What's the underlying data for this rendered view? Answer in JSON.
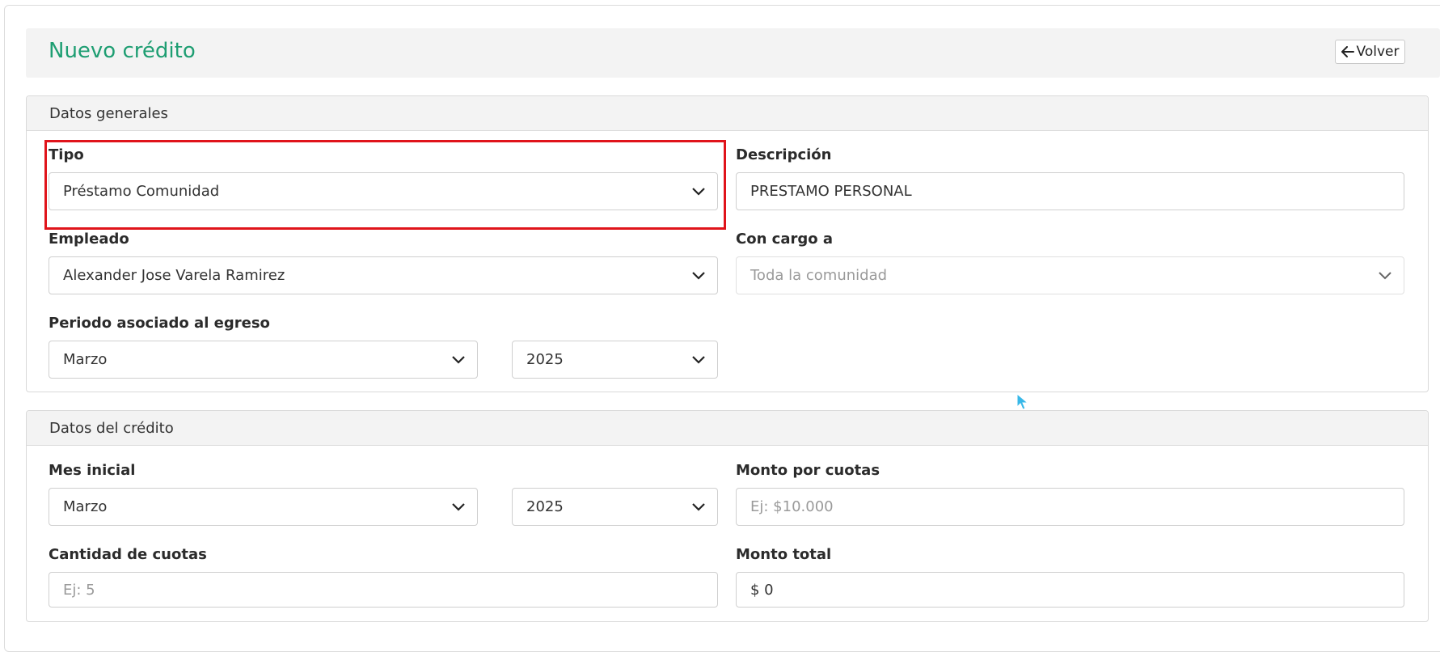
{
  "header": {
    "title": "Nuevo crédito",
    "back_label": "Volver"
  },
  "general": {
    "section_title": "Datos generales",
    "tipo": {
      "label": "Tipo",
      "value": "Préstamo Comunidad"
    },
    "descripcion": {
      "label": "Descripción",
      "value": "PRESTAMO PERSONAL"
    },
    "empleado": {
      "label": "Empleado",
      "value": "Alexander Jose Varela Ramirez"
    },
    "con_cargo": {
      "label": "Con cargo a",
      "value": "Toda la comunidad"
    },
    "periodo": {
      "label": "Periodo asociado al egreso",
      "month": "Marzo",
      "year": "2025"
    }
  },
  "credito": {
    "section_title": "Datos del crédito",
    "mes_inicial": {
      "label": "Mes inicial",
      "month": "Marzo",
      "year": "2025"
    },
    "monto_cuotas": {
      "label": "Monto por cuotas",
      "placeholder": "Ej: $10.000"
    },
    "cantidad_cuotas": {
      "label": "Cantidad de cuotas",
      "placeholder": "Ej: 5"
    },
    "monto_total": {
      "label": "Monto total",
      "value": "$ 0"
    }
  },
  "icons": {
    "back": "arrow-left-icon",
    "dropdown": "chevron-down-icon",
    "cursor": "mouse-pointer-icon"
  },
  "colors": {
    "title": "#1e9e72",
    "highlight": "#e0141b",
    "cursor": "#38b8e8"
  }
}
